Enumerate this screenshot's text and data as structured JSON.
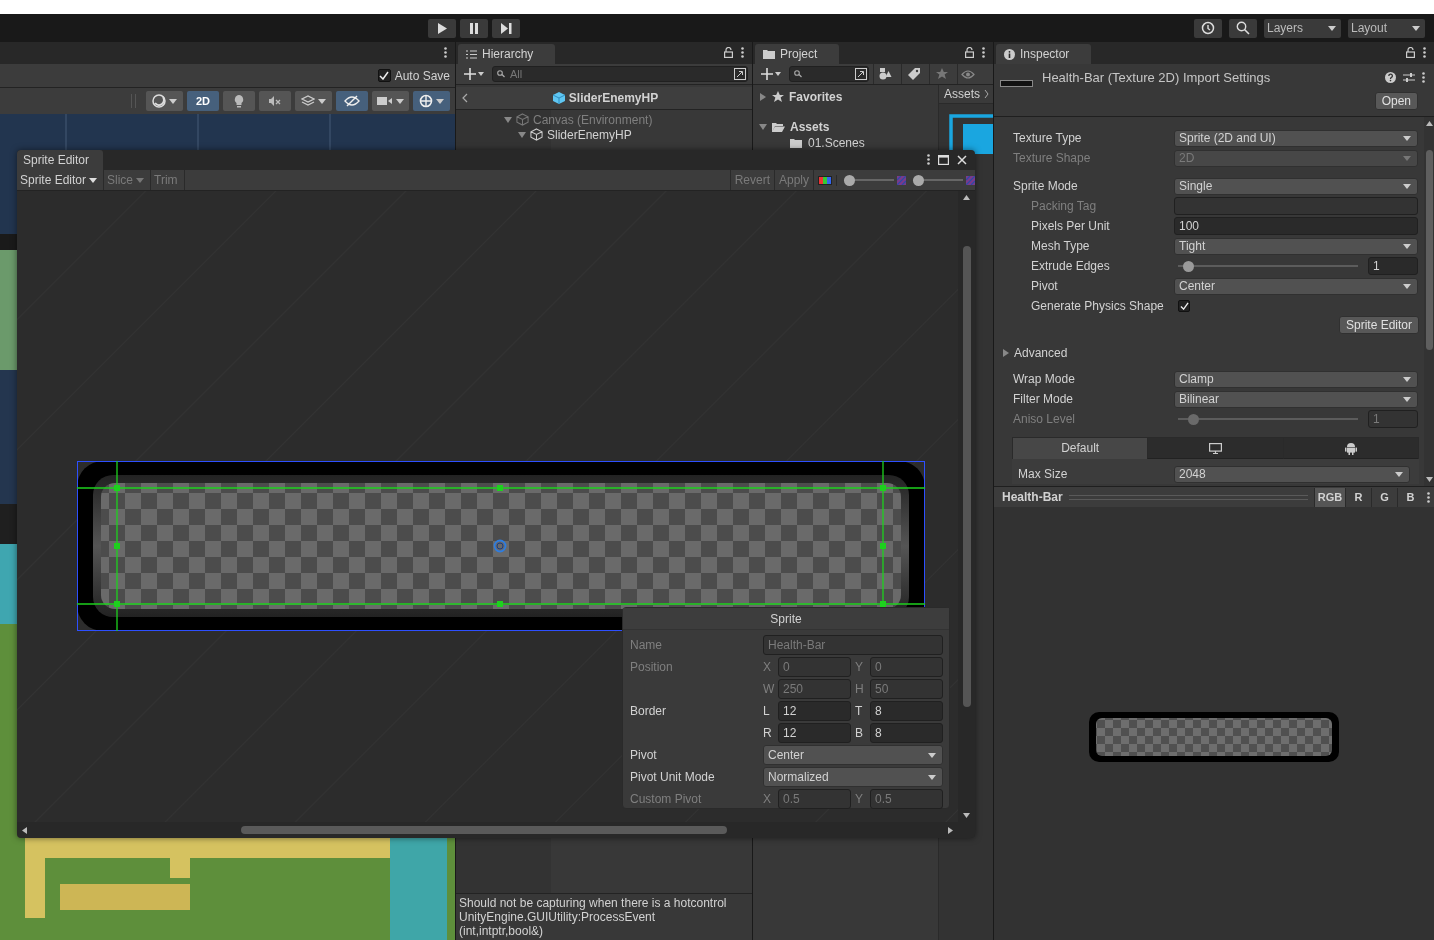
{
  "toolbar": {
    "playback": [
      {
        "kind": "play"
      },
      {
        "kind": "pause"
      },
      {
        "kind": "step"
      }
    ],
    "layers": "Layers",
    "layout": "Layout"
  },
  "scene": {
    "auto_save": {
      "label": "Auto Save",
      "checked": true
    },
    "tools": [
      {
        "kind": "shading",
        "selected": false
      },
      {
        "kind": "mode",
        "label": "2D",
        "selected": true
      },
      {
        "kind": "lighting",
        "selected": false
      },
      {
        "kind": "audio",
        "selected": false
      },
      {
        "kind": "effects",
        "selected": false
      },
      {
        "kind": "visibility",
        "selected": true
      },
      {
        "kind": "camera",
        "selected": false
      },
      {
        "kind": "gizmos",
        "selected": true
      }
    ]
  },
  "hierarchy": {
    "title": "Hierarchy",
    "search_placeholder": "All",
    "breadcrumb": "SliderEnemyHP",
    "tree": [
      {
        "label": "Canvas (Environment)",
        "disabled": true,
        "expanded": true,
        "children": [
          {
            "label": "SliderEnemyHP",
            "disabled": false,
            "expanded": true
          }
        ]
      }
    ]
  },
  "console": {
    "lines": [
      "Should not be capturing when there is a hotcontrol",
      "UnityEngine.GUIUtility:ProcessEvent",
      "(int,intptr,bool&)"
    ]
  },
  "project": {
    "title": "Project",
    "breadcrumb": "Assets",
    "tree": [
      {
        "label": "Favorites",
        "kind": "favorites",
        "expanded": false
      },
      {
        "label": "Assets",
        "kind": "folder",
        "expanded": true,
        "children": [
          {
            "label": "01.Scenes",
            "kind": "folder"
          }
        ]
      }
    ]
  },
  "inspector": {
    "title": "Inspector",
    "header": "Health-Bar (Texture 2D) Import Settings",
    "open_button": "Open",
    "sections": [
      {
        "kind": "fields",
        "fields": [
          {
            "label": "Texture Type",
            "kind": "dropdown",
            "value": "Sprite (2D and UI)",
            "disabled": false,
            "indented": false
          },
          {
            "label": "Texture Shape",
            "kind": "dropdown",
            "value": "2D",
            "disabled": true,
            "indented": false
          }
        ]
      },
      {
        "kind": "fields",
        "fields": [
          {
            "label": "Sprite Mode",
            "kind": "dropdown",
            "value": "Single",
            "disabled": false,
            "indented": false
          },
          {
            "label": "Packing Tag",
            "kind": "text",
            "disabled": true,
            "indented": true
          },
          {
            "label": "Pixels Per Unit",
            "kind": "text",
            "value": "100",
            "disabled": false,
            "indented": true
          },
          {
            "label": "Mesh Type",
            "kind": "dropdown",
            "value": "Tight",
            "disabled": false,
            "indented": true
          },
          {
            "label": "Extrude Edges",
            "kind": "slider",
            "level": 0.03,
            "value": "1",
            "disabled": false,
            "indented": true
          },
          {
            "label": "Pivot",
            "kind": "dropdown",
            "value": "Center",
            "disabled": false,
            "indented": true
          },
          {
            "label": "Generate Physics Shape",
            "kind": "checkbox",
            "checked": true,
            "disabled": false,
            "indented": true
          }
        ]
      },
      {
        "kind": "button",
        "label": "Sprite Editor"
      },
      {
        "kind": "foldout",
        "label": "Advanced",
        "expanded": false
      },
      {
        "kind": "fields",
        "fields": [
          {
            "label": "Wrap Mode",
            "kind": "dropdown",
            "value": "Clamp",
            "disabled": false,
            "indented": false
          },
          {
            "label": "Filter Mode",
            "kind": "dropdown",
            "value": "Bilinear",
            "disabled": false,
            "indented": false
          },
          {
            "label": "Aniso Level",
            "kind": "slider",
            "level": 0.06,
            "value": "1",
            "disabled": true,
            "indented": false
          }
        ]
      }
    ],
    "platform_tabs": [
      {
        "kind": "text",
        "label": "Default",
        "selected": true
      },
      {
        "kind": "standalone",
        "selected": false
      },
      {
        "kind": "android",
        "selected": false
      }
    ],
    "max_size": {
      "label": "Max Size",
      "value": "2048"
    }
  },
  "preview": {
    "name": "Health-Bar",
    "channels": [
      {
        "label": "RGB",
        "selected": true
      },
      {
        "label": "R",
        "selected": false
      },
      {
        "label": "G",
        "selected": false
      },
      {
        "label": "B",
        "selected": false
      }
    ]
  },
  "sprite_editor": {
    "tab": "Sprite Editor",
    "mode_menu": "Sprite Editor",
    "tools": [
      {
        "label": "Slice",
        "kind": "dropdown",
        "disabled": true
      },
      {
        "label": "Trim",
        "kind": "button",
        "disabled": true
      }
    ],
    "actions": [
      {
        "label": "Revert",
        "disabled": true
      },
      {
        "label": "Apply",
        "disabled": true
      }
    ],
    "sliders": [
      {
        "level": 0
      },
      {
        "level": 0
      }
    ],
    "panel": {
      "title": "Sprite",
      "rows": [
        {
          "label": "Name",
          "kind": "text",
          "disabled": true,
          "value": "Health-Bar"
        },
        {
          "label": "Position",
          "kind": "vector",
          "disabled": true,
          "lines": [
            [
              {
                "axis": "X",
                "value": "0"
              },
              {
                "axis": "Y",
                "value": "0"
              }
            ],
            [
              {
                "axis": "W",
                "value": "250"
              },
              {
                "axis": "H",
                "value": "50"
              }
            ]
          ]
        },
        {
          "label": "Border",
          "kind": "vector",
          "disabled": false,
          "lines": [
            [
              {
                "axis": "L",
                "value": "12"
              },
              {
                "axis": "T",
                "value": "8"
              }
            ],
            [
              {
                "axis": "R",
                "value": "12"
              },
              {
                "axis": "B",
                "value": "8"
              }
            ]
          ]
        },
        {
          "label": "Pivot",
          "kind": "dropdown",
          "disabled": false,
          "value": "Center"
        },
        {
          "label": "Pivot Unit Mode",
          "kind": "dropdown",
          "disabled": false,
          "value": "Normalized"
        },
        {
          "label": "Custom Pivot",
          "kind": "vector",
          "disabled": true,
          "lines": [
            [
              {
                "axis": "X",
                "value": "0.5"
              },
              {
                "axis": "Y",
                "value": "0.5"
              }
            ]
          ]
        }
      ]
    }
  }
}
